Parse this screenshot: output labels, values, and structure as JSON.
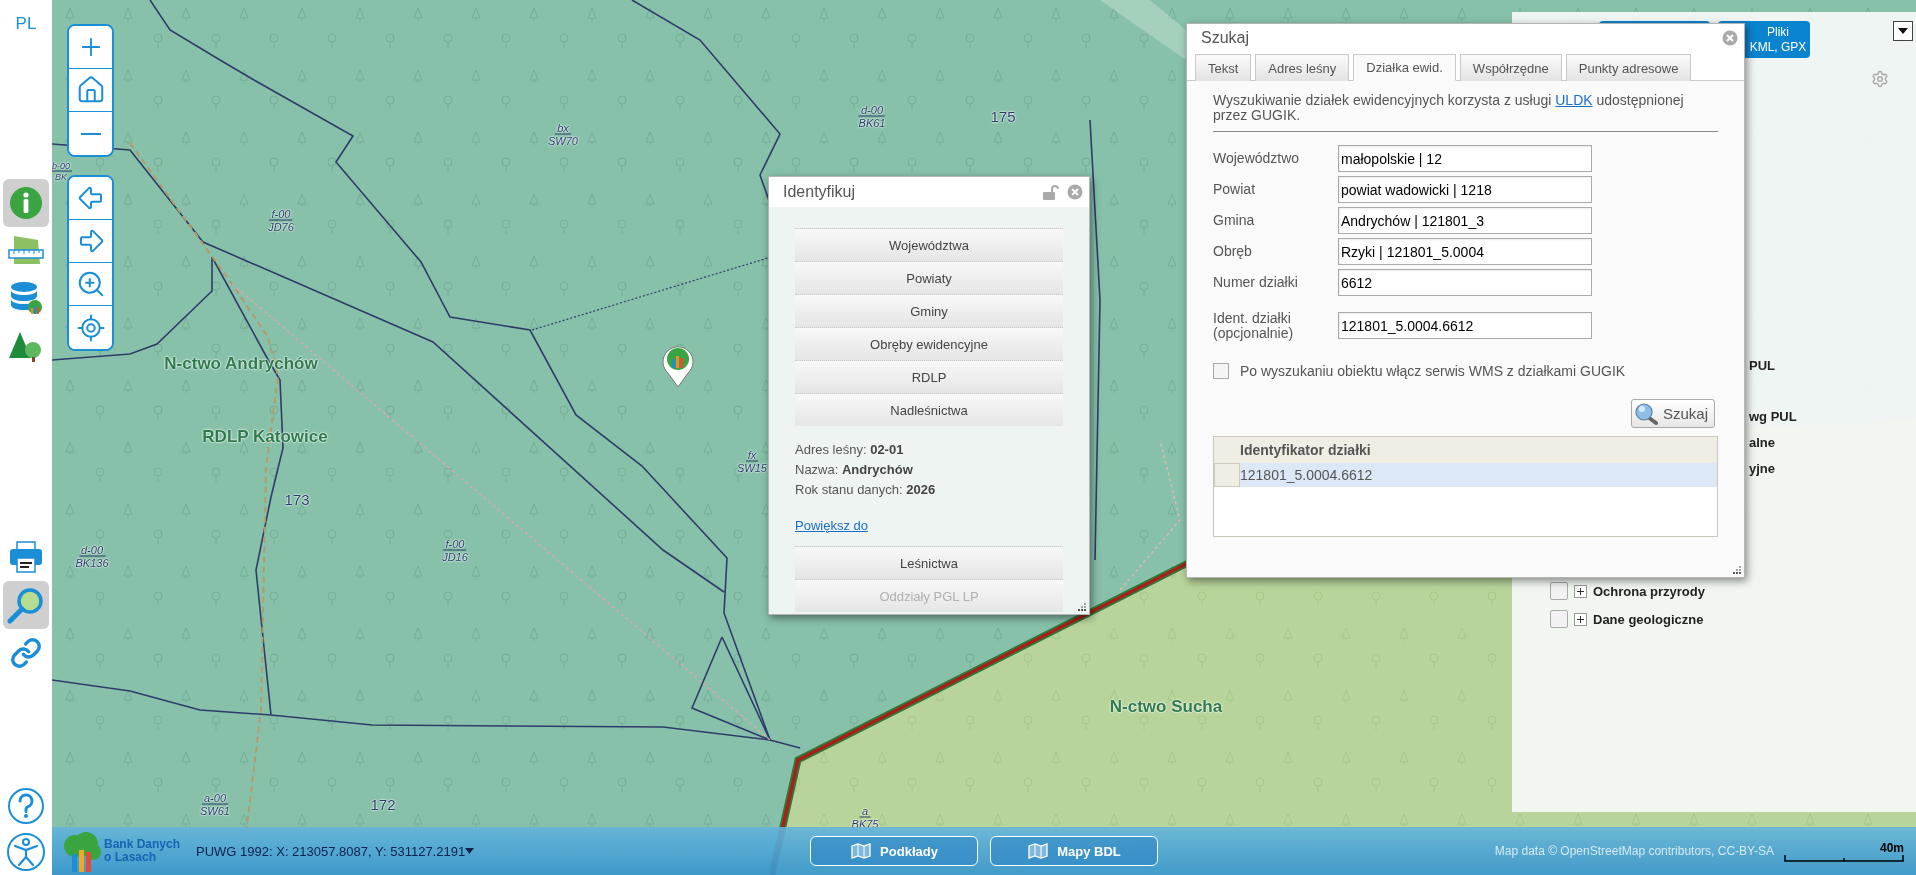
{
  "sidebar": {
    "language": "PL",
    "top_tools": [
      {
        "kind": "info",
        "selected": true
      },
      {
        "kind": "measure",
        "selected": false
      },
      {
        "kind": "data",
        "selected": false
      },
      {
        "kind": "forest",
        "selected": false
      }
    ],
    "middle_tools": [
      {
        "kind": "print",
        "selected": false
      },
      {
        "kind": "search",
        "selected": true
      },
      {
        "kind": "link",
        "selected": false
      }
    ],
    "bottom_tools": [
      {
        "kind": "help",
        "selected": false
      },
      {
        "kind": "accessibility",
        "selected": false
      }
    ]
  },
  "map": {
    "labels": [
      {
        "kind": "fraction",
        "top": "b-00",
        "bottom": "BK"
      },
      {
        "kind": "fraction",
        "top": "bx",
        "bottom": "SW70"
      },
      {
        "kind": "fraction",
        "top": "d-00",
        "bottom": "BK61"
      },
      {
        "kind": "number",
        "text": "175"
      },
      {
        "kind": "fraction",
        "top": "f-00",
        "bottom": "JD76"
      },
      {
        "kind": "area",
        "text": "N-ctwo Andrychów"
      },
      {
        "kind": "area",
        "text": "RDLP Katowice"
      },
      {
        "kind": "number",
        "text": "173"
      },
      {
        "kind": "fraction",
        "top": "d-00",
        "bottom": "BK136"
      },
      {
        "kind": "fraction",
        "top": "f-00",
        "bottom": "JD16"
      },
      {
        "kind": "fraction",
        "top": "fx",
        "bottom": "SW15"
      },
      {
        "kind": "area",
        "text": "N-ctwo Sucha"
      },
      {
        "kind": "fraction",
        "top": "a-00",
        "bottom": "SW61"
      },
      {
        "kind": "number",
        "text": "172"
      },
      {
        "kind": "fraction",
        "top": "a",
        "bottom": "BK75"
      }
    ]
  },
  "identify": {
    "title": "Identyfikuj",
    "layers_top": [
      {
        "label": "Województwa",
        "disabled": false
      },
      {
        "label": "Powiaty",
        "disabled": false
      },
      {
        "label": "Gminy",
        "disabled": false
      },
      {
        "label": "Obręby ewidencyjne",
        "disabled": false
      },
      {
        "label": "RDLP",
        "disabled": false
      },
      {
        "label": "Nadleśnictwa",
        "disabled": false
      }
    ],
    "details": [
      "Adres leśny: **02-01**",
      "Nazwa: **Andrychów**",
      "Rok stanu danych: **2026**"
    ],
    "zoom_link": "Powiększ do",
    "layers_bottom": [
      {
        "label": "Leśnictwa",
        "disabled": false
      },
      {
        "label": "Oddziały PGL LP",
        "disabled": true
      }
    ]
  },
  "search": {
    "title": "Szukaj",
    "tabs": [
      {
        "label": "Tekst",
        "selected": false
      },
      {
        "label": "Adres leśny",
        "selected": false
      },
      {
        "label": "Działka ewid.",
        "selected": true
      },
      {
        "label": "Współrzędne",
        "selected": false
      },
      {
        "label": "Punkty adresowe",
        "selected": false
      }
    ],
    "intro_before": "Wyszukiwanie działek ewidencyjnych korzysta z usługi",
    "intro_link": "ULDK",
    "intro_after": "udostępnionej przez GUGIK.",
    "fields": [
      {
        "label": "Województwo",
        "value": "małopolskie | 12"
      },
      {
        "label": "Powiat",
        "value": "powiat wadowicki | 1218"
      },
      {
        "label": "Gmina",
        "value": "Andrychów | 121801_3"
      },
      {
        "label": "Obręb",
        "value": "Rzyki | 121801_5.0004"
      },
      {
        "label": "Numer działki",
        "value": "6612"
      },
      {
        "label": "Ident. działki (opcjonalnie)",
        "value": "121801_5.0004.6612"
      }
    ],
    "wms_option": {
      "label": "Po wyszukaniu obiektu włącz serwis WMS z działkami GUGIK",
      "checked": false
    },
    "search_button": "Szukaj",
    "results": {
      "columns": [
        "Identyfikator działki"
      ],
      "rows": [
        {
          "cells": [
            "121801_5.0004.6612"
          ],
          "selected": true
        }
      ]
    }
  },
  "right_panel": {
    "file_button": [
      "Pliki",
      "KML, GPX"
    ],
    "layers": [
      {
        "kind": "cut",
        "label": "PUL"
      },
      {
        "kind": "cut",
        "label": "wg PUL"
      },
      {
        "kind": "cut",
        "label": "alne"
      },
      {
        "kind": "cut",
        "label": "yjne"
      },
      {
        "kind": "group",
        "label": "Ochrona przyrody",
        "checked": false
      },
      {
        "kind": "group",
        "label": "Dane geologiczne",
        "checked": false
      }
    ]
  },
  "bottom_bar": {
    "logo": [
      "Bank Danych",
      "o Lasach"
    ],
    "coordinates": "PUWG 1992: X: 213057.8087, Y: 531127.2191",
    "buttons": [
      "Podkłady",
      "Mapy BDL"
    ],
    "attribution": "Map data © OpenStreetMap contributors, CC-BY-SA",
    "scale": "40m"
  }
}
